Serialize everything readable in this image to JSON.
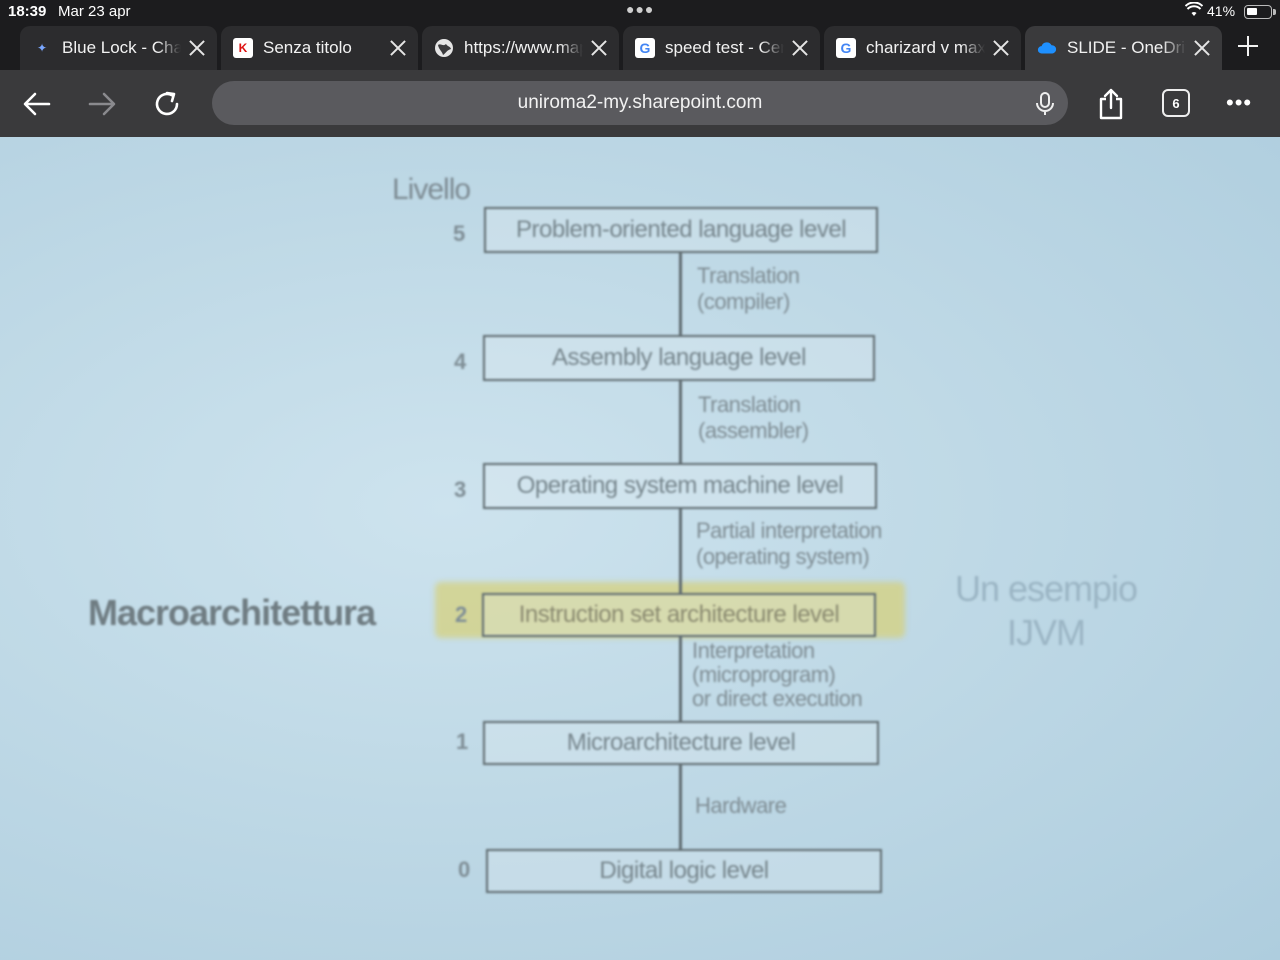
{
  "status_bar": {
    "time": "18:39",
    "date": "Mar 23 apr",
    "battery": "41%"
  },
  "tabs": [
    {
      "title": "Blue Lock - Chapter",
      "icon": "bluelock-favicon-icon",
      "active": false
    },
    {
      "title": "Senza titolo",
      "icon": "k-favicon-icon",
      "active": false
    },
    {
      "title": "https://www.maps",
      "icon": "globe-icon",
      "active": false
    },
    {
      "title": "speed test - Cerca",
      "icon": "google-icon",
      "active": false
    },
    {
      "title": "charizard v max",
      "icon": "google-icon",
      "active": false
    },
    {
      "title": "SLIDE - OneDrive",
      "icon": "onedrive-icon",
      "active": true
    }
  ],
  "toolbar": {
    "url": "uniroma2-my.sharepoint.com",
    "tab_count": "6"
  },
  "slide": {
    "livello_label": "Livello",
    "levels": [
      {
        "num": "5",
        "label": "Problem-oriented language level"
      },
      {
        "num": "4",
        "label": "Assembly language level"
      },
      {
        "num": "3",
        "label": "Operating system machine level"
      },
      {
        "num": "2",
        "label": "Instruction set architecture level"
      },
      {
        "num": "1",
        "label": "Microarchitecture level"
      },
      {
        "num": "0",
        "label": "Digital logic level"
      }
    ],
    "transitions": [
      {
        "line1": "Translation",
        "line2": "(compiler)",
        "line3": ""
      },
      {
        "line1": "Translation",
        "line2": "(assembler)",
        "line3": ""
      },
      {
        "line1": "Partial interpretation",
        "line2": "(operating system)",
        "line3": ""
      },
      {
        "line1": "Interpretation",
        "line2": "(microprogram)",
        "line3": "or direct execution"
      },
      {
        "line1": "Hardware",
        "line2": "",
        "line3": ""
      }
    ],
    "macro_label": "Macroarchitettura",
    "example_line1": "Un esempio",
    "example_line2": "IJVM",
    "colors": {
      "background": "#c3dce8",
      "highlight": "#d6d078"
    }
  }
}
